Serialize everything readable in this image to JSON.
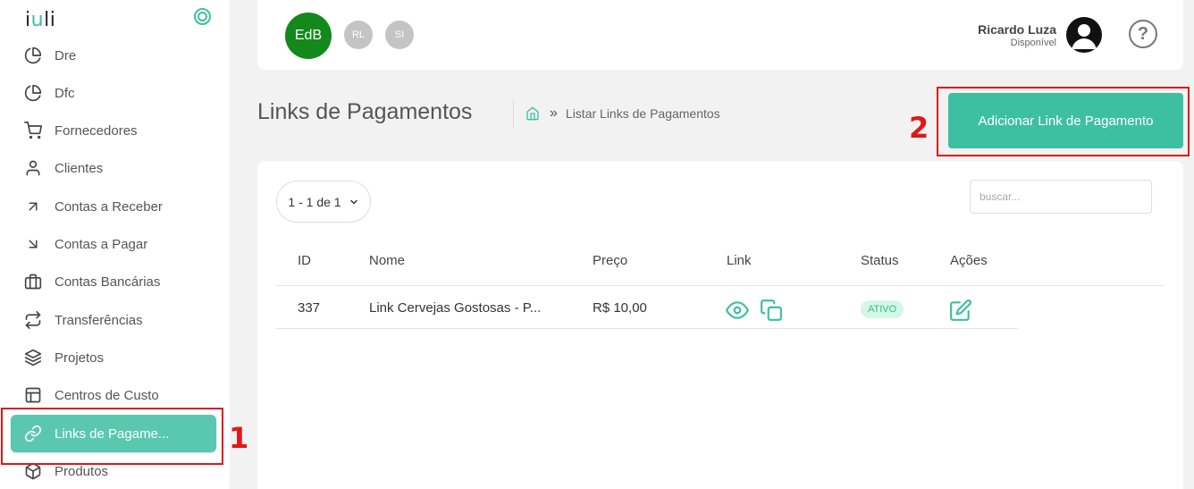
{
  "app": {
    "logo_text_a": "i",
    "logo_text_u": "u",
    "logo_text_b": "li"
  },
  "sidebar": {
    "items": [
      {
        "label": "Dre",
        "icon": "pie-chart-icon"
      },
      {
        "label": "Dfc",
        "icon": "pie-chart-icon"
      },
      {
        "label": "Fornecedores",
        "icon": "cart-icon"
      },
      {
        "label": "Clientes",
        "icon": "user-icon"
      },
      {
        "label": "Contas a Receber",
        "icon": "arrow-up-right-icon"
      },
      {
        "label": "Contas a Pagar",
        "icon": "arrow-down-right-icon"
      },
      {
        "label": "Contas Bancárias",
        "icon": "briefcase-icon"
      },
      {
        "label": "Transferências",
        "icon": "repeat-icon"
      },
      {
        "label": "Projetos",
        "icon": "layers-icon"
      },
      {
        "label": "Centros de Custo",
        "icon": "layout-icon"
      },
      {
        "label": "Links de Pagame...",
        "icon": "link-icon",
        "active": true
      },
      {
        "label": "Produtos",
        "icon": "box-icon"
      }
    ]
  },
  "annotations": {
    "one": "1",
    "two": "2",
    "color": "#e01818"
  },
  "topbar": {
    "company_avatar": "EdB",
    "small_avatars": [
      "RL",
      "SI"
    ],
    "user_name": "Ricardo Luza",
    "user_status": "Disponível"
  },
  "page": {
    "title": "Links de Pagamentos",
    "breadcrumb_sep": "»",
    "breadcrumb_current": "Listar Links de Pagamentos",
    "add_button": "Adicionar Link de Pagamento"
  },
  "table": {
    "pager": "1 - 1 de 1",
    "search_placeholder": "buscar...",
    "columns": [
      "ID",
      "Nome",
      "Preço",
      "Link",
      "Status",
      "Ações"
    ],
    "rows": [
      {
        "id": "337",
        "nome": "Link Cervejas Gostosas - P...",
        "preco": "R$ 10,00",
        "status": "ATIVO"
      }
    ]
  },
  "colors": {
    "accent": "#3dbfa2",
    "company_avatar": "#12891a",
    "badge_bg": "#d4f5e8",
    "badge_text": "#2dbf8a"
  }
}
